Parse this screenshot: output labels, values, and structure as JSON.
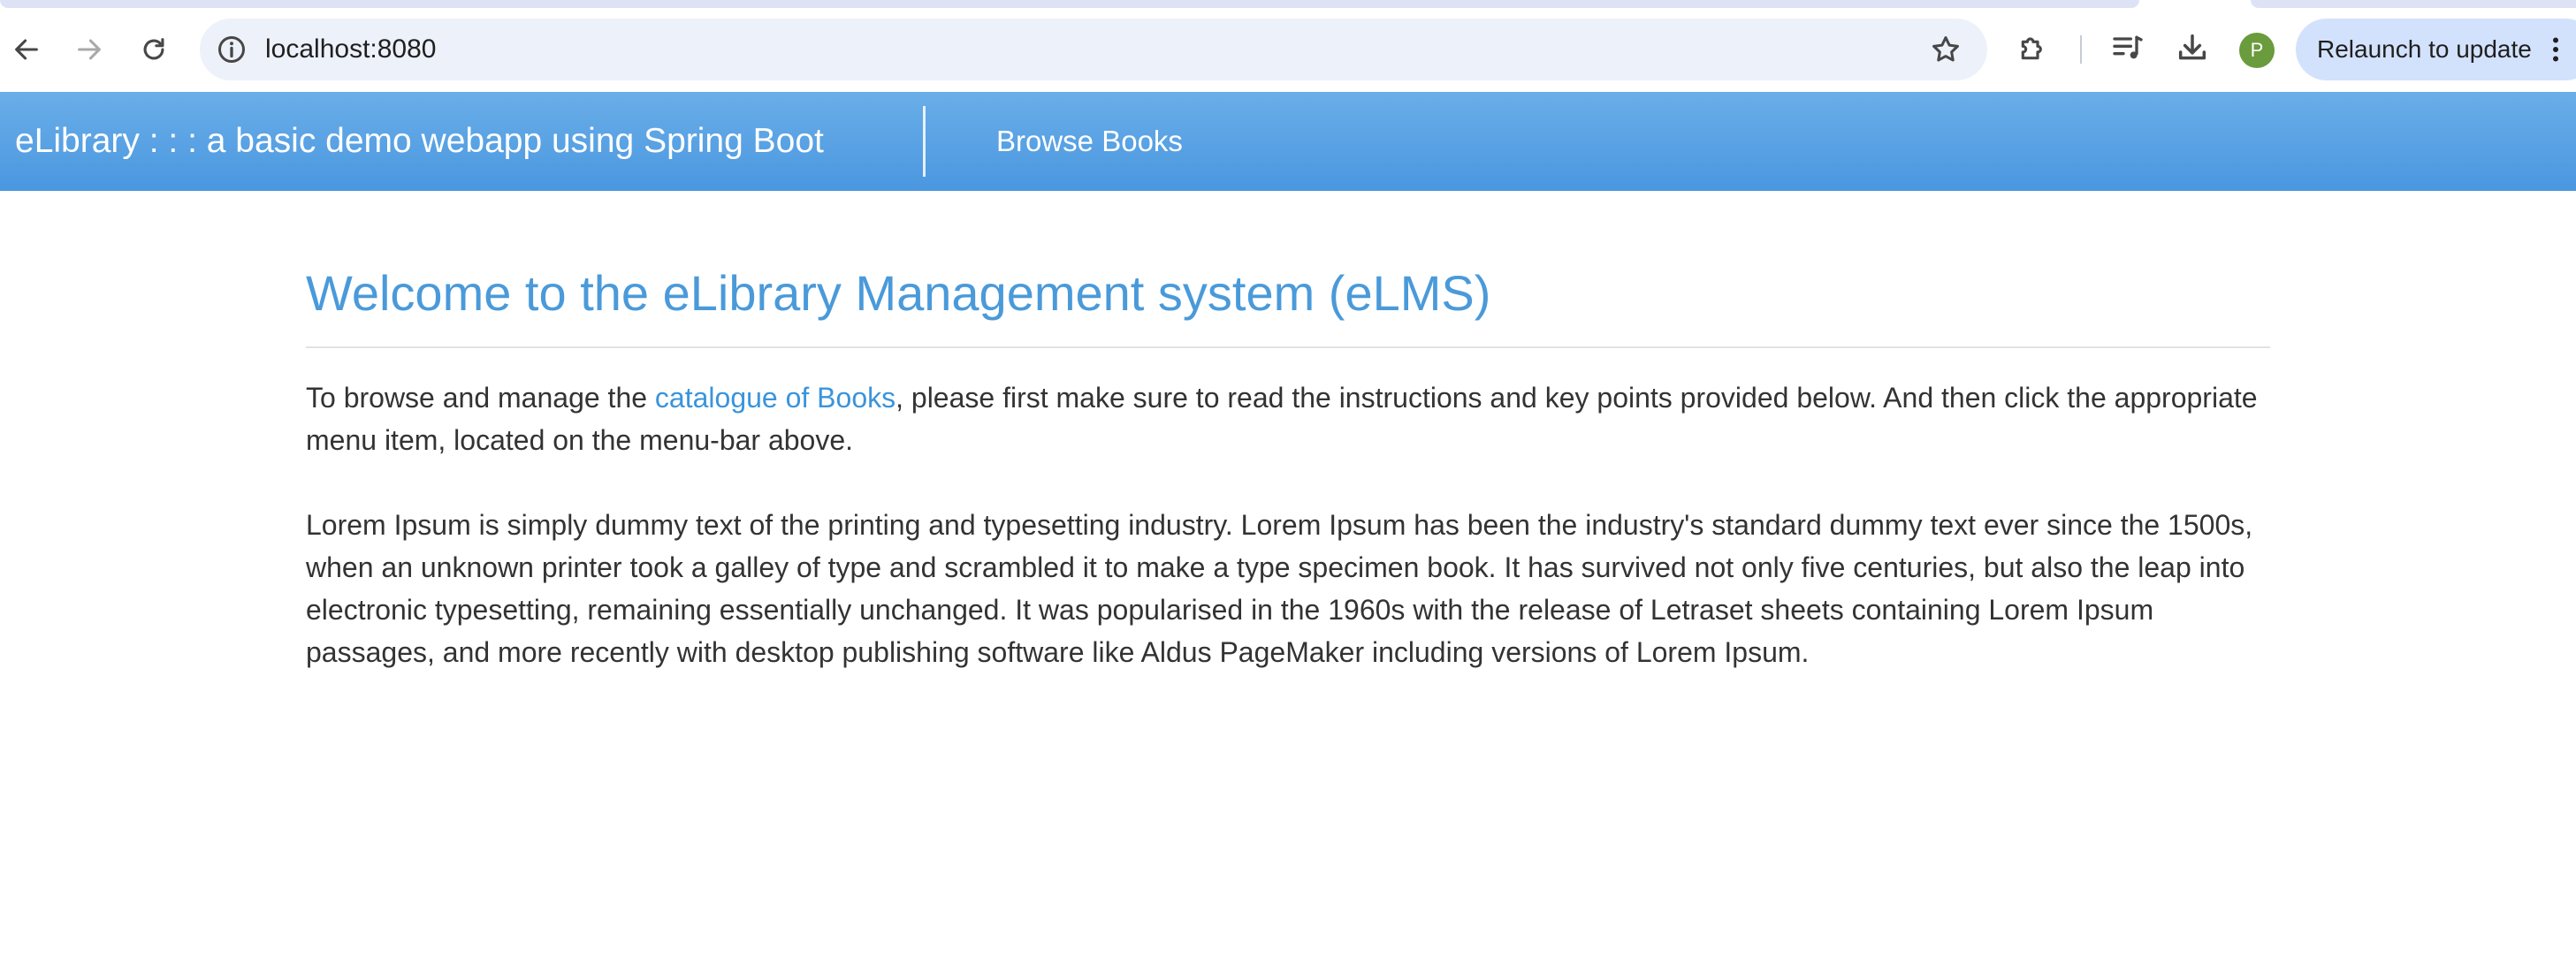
{
  "browser": {
    "url": "localhost:8080",
    "relaunch_label": "Relaunch to update",
    "profile_initial": "P",
    "profile_color": "#6a9b3c",
    "icons": [
      "back-icon",
      "forward-icon",
      "reload-icon",
      "site-info-icon",
      "bookmark-star-icon",
      "extensions-icon",
      "media-controls-icon",
      "downloads-icon",
      "kebab-menu-icon"
    ]
  },
  "navbar": {
    "brand": "eLibrary : : : a basic demo webapp using Spring Boot",
    "links": [
      {
        "label": "Browse Books"
      }
    ],
    "gradient_top": "#6aaee8",
    "gradient_bottom": "#4a97e0"
  },
  "main": {
    "title": "Welcome to the eLibrary Management system (eLMS)",
    "title_color": "#4a9ada",
    "intro": {
      "before": "To browse and manage the ",
      "link": "catalogue of Books",
      "after": ", please first make sure to read the instructions and key points provided below. And then click the appropriate menu item, located on the menu-bar above."
    },
    "lorem": "Lorem Ipsum is simply dummy text of the printing and typesetting industry. Lorem Ipsum has been the industry's standard dummy text ever since the 1500s, when an unknown printer took a galley of type and scrambled it to make a type specimen book. It has survived not only five centuries, but also the leap into electronic typesetting, remaining essentially unchanged. It was popularised in the 1960s with the release of Letraset sheets containing Lorem Ipsum passages, and more recently with desktop publishing software like Aldus PageMaker including versions of Lorem Ipsum."
  }
}
